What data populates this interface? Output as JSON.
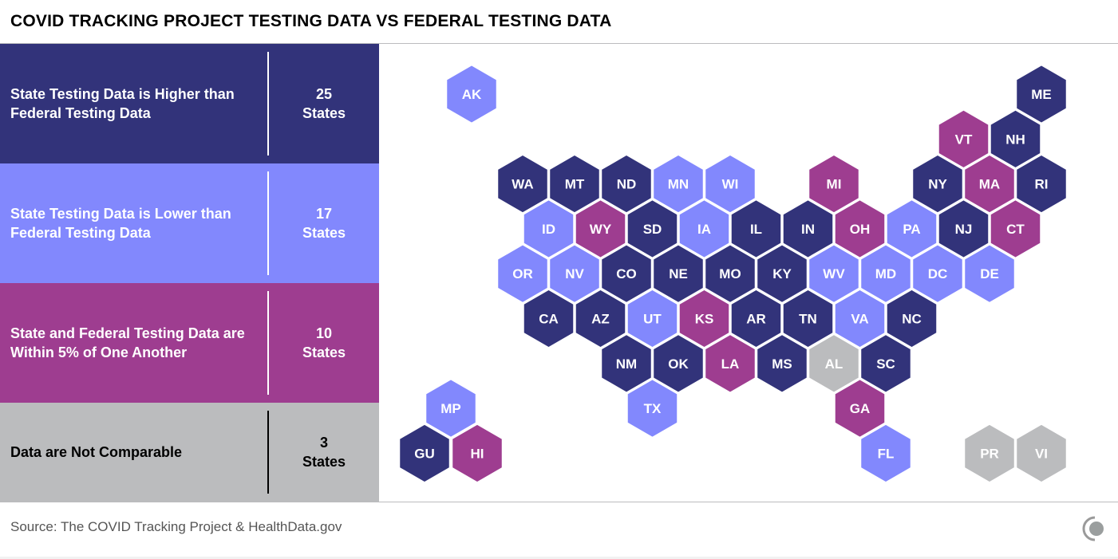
{
  "title": "COVID TRACKING PROJECT TESTING DATA VS FEDERAL TESTING DATA",
  "source": "Source: The COVID Tracking Project & HealthData.gov",
  "colors": {
    "higher": "#32337a",
    "lower": "#8288fd",
    "within": "#9e3d90",
    "not_comparable": "#bbbcbe",
    "text_light": "#ffffff",
    "text_dark": "#000000"
  },
  "legend": [
    {
      "key": "higher",
      "label": "State Testing Data is Higher than Federal Testing Data",
      "count_number": "25",
      "count_unit": "States",
      "text": "light"
    },
    {
      "key": "lower",
      "label": "State Testing Data is Lower than Federal Testing Data",
      "count_number": "17",
      "count_unit": "States",
      "text": "light"
    },
    {
      "key": "within",
      "label": "State and Federal Testing Data are Within 5% of One Another",
      "count_number": "10",
      "count_unit": "States",
      "text": "light"
    },
    {
      "key": "not_comparable",
      "label": "Data are Not Comparable",
      "count_number": "3",
      "count_unit": "States",
      "text": "dark"
    }
  ],
  "chart_data": {
    "type": "heatmap",
    "subtype": "hex-tile-map",
    "title": "COVID TRACKING PROJECT TESTING DATA VS FEDERAL TESTING DATA",
    "categories": [
      "higher",
      "lower",
      "within",
      "not_comparable"
    ],
    "category_labels": {
      "higher": "State Testing Data is Higher than Federal Testing Data",
      "lower": "State Testing Data is Lower than Federal Testing Data",
      "within": "State and Federal Testing Data are Within 5% of One Another",
      "not_comparable": "Data are Not Comparable"
    },
    "category_counts": {
      "higher": 25,
      "lower": 17,
      "within": 10,
      "not_comparable": 3
    },
    "states": [
      {
        "abbr": "AK",
        "category": "lower",
        "row": 0,
        "col": 1
      },
      {
        "abbr": "ME",
        "category": "higher",
        "row": 0,
        "col": 12
      },
      {
        "abbr": "VT",
        "category": "within",
        "row": 1,
        "col": 10
      },
      {
        "abbr": "NH",
        "category": "higher",
        "row": 1,
        "col": 11
      },
      {
        "abbr": "WA",
        "category": "higher",
        "row": 2,
        "col": 2
      },
      {
        "abbr": "MT",
        "category": "higher",
        "row": 2,
        "col": 3
      },
      {
        "abbr": "ND",
        "category": "higher",
        "row": 2,
        "col": 4
      },
      {
        "abbr": "MN",
        "category": "lower",
        "row": 2,
        "col": 5
      },
      {
        "abbr": "WI",
        "category": "lower",
        "row": 2,
        "col": 6
      },
      {
        "abbr": "MI",
        "category": "within",
        "row": 2,
        "col": 8
      },
      {
        "abbr": "NY",
        "category": "higher",
        "row": 2,
        "col": 10
      },
      {
        "abbr": "MA",
        "category": "within",
        "row": 2,
        "col": 11
      },
      {
        "abbr": "RI",
        "category": "higher",
        "row": 2,
        "col": 12
      },
      {
        "abbr": "ID",
        "category": "lower",
        "row": 3,
        "col": 2
      },
      {
        "abbr": "WY",
        "category": "within",
        "row": 3,
        "col": 3
      },
      {
        "abbr": "SD",
        "category": "higher",
        "row": 3,
        "col": 4
      },
      {
        "abbr": "IA",
        "category": "lower",
        "row": 3,
        "col": 5
      },
      {
        "abbr": "IL",
        "category": "higher",
        "row": 3,
        "col": 6
      },
      {
        "abbr": "IN",
        "category": "higher",
        "row": 3,
        "col": 7
      },
      {
        "abbr": "OH",
        "category": "within",
        "row": 3,
        "col": 8
      },
      {
        "abbr": "PA",
        "category": "lower",
        "row": 3,
        "col": 9
      },
      {
        "abbr": "NJ",
        "category": "higher",
        "row": 3,
        "col": 10
      },
      {
        "abbr": "CT",
        "category": "within",
        "row": 3,
        "col": 11
      },
      {
        "abbr": "OR",
        "category": "lower",
        "row": 4,
        "col": 2
      },
      {
        "abbr": "NV",
        "category": "lower",
        "row": 4,
        "col": 3
      },
      {
        "abbr": "CO",
        "category": "higher",
        "row": 4,
        "col": 4
      },
      {
        "abbr": "NE",
        "category": "higher",
        "row": 4,
        "col": 5
      },
      {
        "abbr": "MO",
        "category": "higher",
        "row": 4,
        "col": 6
      },
      {
        "abbr": "KY",
        "category": "higher",
        "row": 4,
        "col": 7
      },
      {
        "abbr": "WV",
        "category": "lower",
        "row": 4,
        "col": 8
      },
      {
        "abbr": "MD",
        "category": "lower",
        "row": 4,
        "col": 9
      },
      {
        "abbr": "DC",
        "category": "lower",
        "row": 4,
        "col": 10
      },
      {
        "abbr": "DE",
        "category": "lower",
        "row": 4,
        "col": 11
      },
      {
        "abbr": "CA",
        "category": "higher",
        "row": 5,
        "col": 2
      },
      {
        "abbr": "AZ",
        "category": "higher",
        "row": 5,
        "col": 3
      },
      {
        "abbr": "UT",
        "category": "lower",
        "row": 5,
        "col": 4
      },
      {
        "abbr": "KS",
        "category": "within",
        "row": 5,
        "col": 5
      },
      {
        "abbr": "AR",
        "category": "higher",
        "row": 5,
        "col": 6
      },
      {
        "abbr": "TN",
        "category": "higher",
        "row": 5,
        "col": 7
      },
      {
        "abbr": "VA",
        "category": "lower",
        "row": 5,
        "col": 8
      },
      {
        "abbr": "NC",
        "category": "higher",
        "row": 5,
        "col": 9
      },
      {
        "abbr": "NM",
        "category": "higher",
        "row": 6,
        "col": 4
      },
      {
        "abbr": "OK",
        "category": "higher",
        "row": 6,
        "col": 5
      },
      {
        "abbr": "LA",
        "category": "within",
        "row": 6,
        "col": 6
      },
      {
        "abbr": "MS",
        "category": "higher",
        "row": 6,
        "col": 7
      },
      {
        "abbr": "AL",
        "category": "not_comparable",
        "row": 6,
        "col": 8
      },
      {
        "abbr": "SC",
        "category": "higher",
        "row": 6,
        "col": 9
      },
      {
        "abbr": "MP",
        "category": "lower",
        "row": 7,
        "col": 0
      },
      {
        "abbr": "TX",
        "category": "lower",
        "row": 7,
        "col": 4
      },
      {
        "abbr": "GA",
        "category": "within",
        "row": 7,
        "col": 8
      },
      {
        "abbr": "GU",
        "category": "higher",
        "row": 8,
        "col": 0
      },
      {
        "abbr": "HI",
        "category": "within",
        "row": 8,
        "col": 1
      },
      {
        "abbr": "FL",
        "category": "lower",
        "row": 8,
        "col": 9
      },
      {
        "abbr": "PR",
        "category": "not_comparable",
        "row": 8,
        "col": 11
      },
      {
        "abbr": "VI",
        "category": "not_comparable",
        "row": 8,
        "col": 12
      }
    ],
    "legend_position": "left"
  }
}
